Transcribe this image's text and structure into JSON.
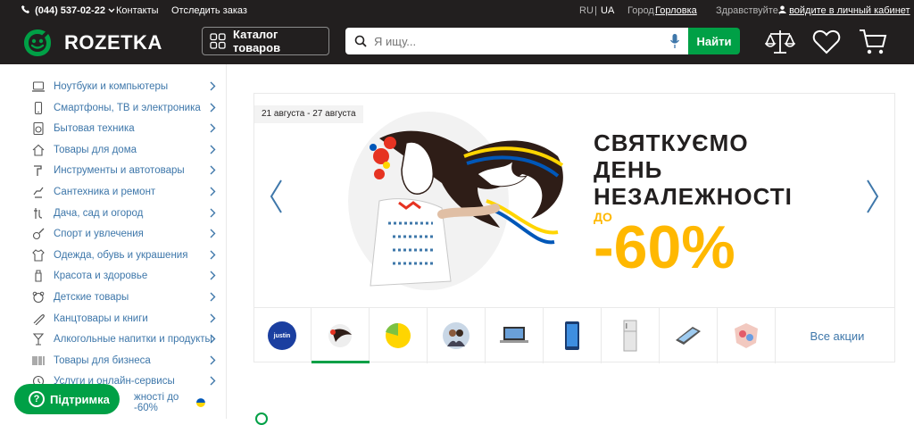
{
  "topbar": {
    "phone": "(044) 537-02-22",
    "contacts": "Контакты",
    "track_order": "Отследить заказ",
    "lang_ru": "RU",
    "lang_sep": "|",
    "lang_ua": "UA",
    "city_label": "Город",
    "city": "Горловка",
    "greeting": "Здравствуйте,",
    "login": "войдите в личный кабинет"
  },
  "header": {
    "logo_text": "ROZETKA",
    "catalog_label": "Каталог товаров",
    "search_placeholder": "Я ищу...",
    "search_button": "Найти"
  },
  "sidebar": {
    "items": [
      {
        "label": "Ноутбуки и компьютеры"
      },
      {
        "label": "Смартфоны, ТВ и электроника"
      },
      {
        "label": "Бытовая техника"
      },
      {
        "label": "Товары для дома"
      },
      {
        "label": "Инструменты и автотовары"
      },
      {
        "label": "Сантехника и ремонт"
      },
      {
        "label": "Дача, сад и огород"
      },
      {
        "label": "Спорт и увлечения"
      },
      {
        "label": "Одежда, обувь и украшения"
      },
      {
        "label": "Красота и здоровье"
      },
      {
        "label": "Детские товары"
      },
      {
        "label": "Канцтовары и книги"
      },
      {
        "label": "Алкогольные напитки и продукты"
      },
      {
        "label": "Товары для бизнеса"
      },
      {
        "label": "Услуги и онлайн-сервисы"
      },
      {
        "label": "жності до -60%"
      }
    ]
  },
  "banner": {
    "date_range": "21 августа - 27 августа",
    "headline_1": "СВЯТКУЄМО",
    "headline_2": "ДЕНЬ",
    "headline_3": "НЕЗАЛЕЖНОСТІ",
    "discount_prefix": "ДО",
    "discount": "-60%",
    "thumb_logo_text": "justin",
    "all_promotions": "Все акции"
  },
  "support": {
    "label": "Підтримка"
  },
  "colors": {
    "accent_green": "#00a046",
    "dark_bg": "#221f1f",
    "link_blue": "#3e77aa",
    "promo_yellow": "#ffb800"
  }
}
